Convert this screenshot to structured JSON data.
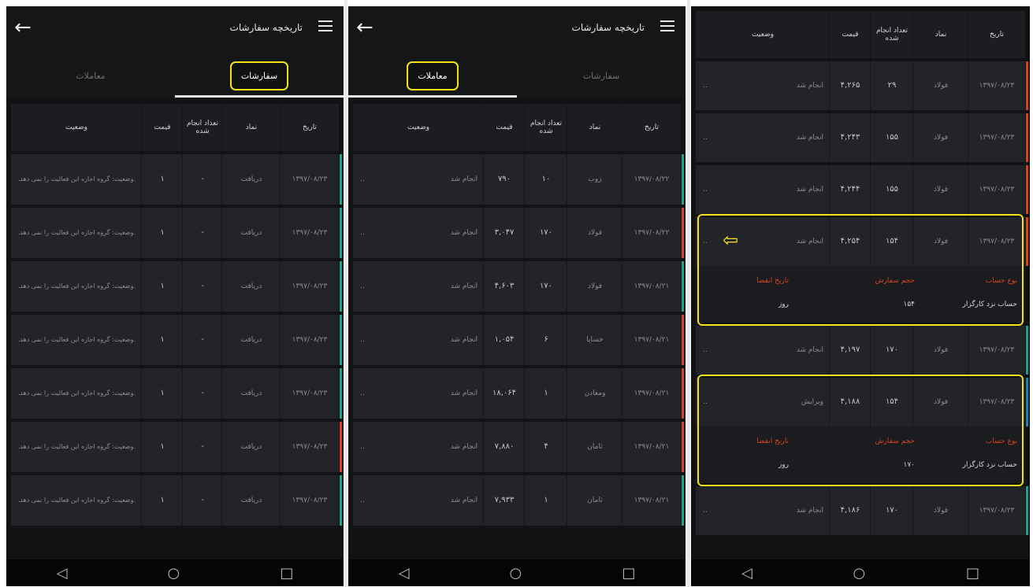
{
  "left": {
    "title": "تاریخچه سفارشات",
    "tabs": [
      "معاملات",
      "سفارشات"
    ],
    "headers": [
      "وضعیت",
      "قیمت",
      "تعداد انجام شده",
      "نماد",
      "تاریخ"
    ],
    "rows": [
      {
        "date": "۱۳۹۷/۰۸/۲۳",
        "symbol": "دریافت",
        "done": "-",
        "price": "۱",
        "status": "وضعیت: گروه اجازه این فعالیت را نمی دهد.",
        "indicator": "green"
      },
      {
        "date": "۱۳۹۷/۰۸/۲۳",
        "symbol": "دریافت",
        "done": "-",
        "price": "۱",
        "status": "وضعیت: گروه اجازه این فعالیت را نمی دهد.",
        "indicator": "green"
      },
      {
        "date": "۱۳۹۷/۰۸/۲۳",
        "symbol": "دریافت",
        "done": "-",
        "price": "۱",
        "status": "وضعیت: گروه اجازه این فعالیت را نمی دهد.",
        "indicator": "green"
      },
      {
        "date": "۱۳۹۷/۰۸/۲۳",
        "symbol": "دریافت",
        "done": "-",
        "price": "۱",
        "status": "وضعیت: گروه اجازه این فعالیت را نمی دهد.",
        "indicator": "green"
      },
      {
        "date": "۱۳۹۷/۰۸/۲۳",
        "symbol": "دریافت",
        "done": "-",
        "price": "۱",
        "status": "وضعیت: گروه اجازه این فعالیت را نمی دهد.",
        "indicator": "green"
      },
      {
        "date": "۱۳۹۷/۰۸/۲۳",
        "symbol": "دریافت",
        "done": "-",
        "price": "۱",
        "status": "وضعیت: گروه اجازه این فعالیت را نمی دهد.",
        "indicator": "red"
      },
      {
        "date": "۱۳۹۷/۰۸/۲۳",
        "symbol": "دریافت",
        "done": "-",
        "price": "۱",
        "status": "وضعیت: گروه اجازه این فعالیت را نمی دهد.",
        "indicator": "green"
      }
    ]
  },
  "middle": {
    "title": "تاریخچه سفارشات",
    "tabs": [
      "معاملات",
      "سفارشات"
    ],
    "headers": [
      "وضعیت",
      "قیمت",
      "تعداد انجام شده",
      "نماد",
      "تاریخ"
    ],
    "rows": [
      {
        "date": "۱۳۹۷/۰۸/۲۲",
        "symbol": "زوب",
        "done": "۱۰",
        "price": "۷۹۰",
        "status": "انجام شد",
        "indicator": "green"
      },
      {
        "date": "۱۳۹۷/۰۸/۲۲",
        "symbol": "فولاد",
        "done": "۱۷۰",
        "price": "۳,۰۴۷",
        "status": "انجام شد",
        "indicator": "red"
      },
      {
        "date": "۱۳۹۷/۰۸/۲۱",
        "symbol": "فولاد",
        "done": "۱۷۰",
        "price": "۴,۶۰۳",
        "status": "انجام شد",
        "indicator": "green"
      },
      {
        "date": "۱۳۹۷/۰۸/۲۱",
        "symbol": "خساپا",
        "done": "۶",
        "price": "۱,۰۵۴",
        "status": "انجام شد",
        "indicator": "red"
      },
      {
        "date": "۱۳۹۷/۰۸/۲۱",
        "symbol": "ومعادن",
        "done": "۱",
        "price": "۱۸,۰۶۴",
        "status": "انجام شد",
        "indicator": "red"
      },
      {
        "date": "۱۳۹۷/۰۸/۲۱",
        "symbol": "ثامان",
        "done": "۴",
        "price": "۷,۸۸۰",
        "status": "انجام شد",
        "indicator": "red"
      },
      {
        "date": "۱۳۹۷/۰۸/۲۱",
        "symbol": "ثامان",
        "done": "۱",
        "price": "۷,۹۳۳",
        "status": "انجام شد",
        "indicator": "green"
      }
    ]
  },
  "right": {
    "headers": [
      "وضعیت",
      "قیمت",
      "تعداد انجام شده",
      "نماد",
      "تاریخ"
    ],
    "rows": [
      {
        "date": "۱۳۹۷/۰۸/۲۳",
        "symbol": "فولاد",
        "done": "۲۹",
        "price": "۴,۲۶۵",
        "status": "انجام شد",
        "indicator": "red"
      },
      {
        "date": "۱۳۹۷/۰۸/۲۳",
        "symbol": "فولاد",
        "done": "۱۵۵",
        "price": "۴,۲۴۳",
        "status": "انجام شد",
        "indicator": "red"
      },
      {
        "date": "۱۳۹۷/۰۸/۲۳",
        "symbol": "فولاد",
        "done": "۱۵۵",
        "price": "۴,۲۴۴",
        "status": "انجام شد",
        "indicator": "red"
      },
      {
        "date": "۱۳۹۷/۰۸/۲۳",
        "symbol": "فولاد",
        "done": "۱۵۴",
        "price": "۴,۲۵۴",
        "status": "انجام شد",
        "indicator": "red"
      },
      {
        "date": "۱۳۹۷/۰۸/۲۳",
        "symbol": "فولاد",
        "done": "۱۷۰",
        "price": "۴,۱۹۷",
        "status": "انجام شد",
        "indicator": "green"
      },
      {
        "date": "۱۳۹۷/۰۸/۲۳",
        "symbol": "فولاد",
        "done": "۱۵۴",
        "price": "۴,۱۸۸",
        "status": "ویرایش",
        "indicator": "blue"
      },
      {
        "date": "۱۳۹۷/۰۸/۲۳",
        "symbol": "فولاد",
        "done": "۱۷۰",
        "price": "۴,۱۸۶",
        "status": "انجام شد",
        "indicator": "green"
      }
    ],
    "detail_labels": [
      "نوع حساب",
      "حجم سفارش",
      "تاریخ انقضا"
    ],
    "detail1": [
      "حساب نزد کارگزار",
      "۱۵۴",
      "روز"
    ],
    "detail2": [
      "حساب نزد کارگزار",
      "۱۷۰",
      "روز"
    ]
  },
  "nav": [
    "◁",
    "○",
    "□"
  ],
  "colors": {
    "accent": "#f2e21a",
    "green": "#18a58a",
    "red": "#d9441e",
    "blue": "#1f7fb5"
  }
}
